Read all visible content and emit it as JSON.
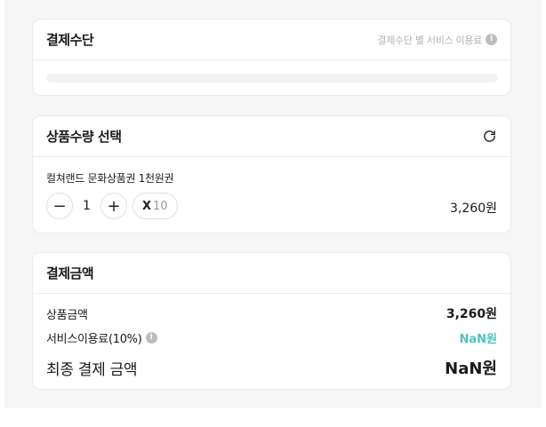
{
  "payment_method": {
    "title": "결제수단",
    "service_fee_hint": "결제수단 별 서비스 이용료",
    "info_icon": "i"
  },
  "quantity_section": {
    "title": "상품수량 선택",
    "refresh_icon": "refresh-icon",
    "product_name": "컬쳐랜드 문화상품권 1천원권",
    "minus_label": "−",
    "quantity": "1",
    "plus_label": "+",
    "multiplier_x": "X",
    "multiplier_value": "10",
    "price": "3,260원"
  },
  "payment_amount": {
    "title": "결제금액",
    "product_amount_label": "상품금액",
    "product_amount_value": "3,260원",
    "service_fee_label": "서비스이용료(10%)",
    "service_fee_value": "NaN원",
    "total_label": "최종 결제 금액",
    "total_value": "NaN원"
  },
  "colors": {
    "accent_teal": "#4fc2c0",
    "background": "#f6f6f6",
    "card": "#ffffff"
  }
}
